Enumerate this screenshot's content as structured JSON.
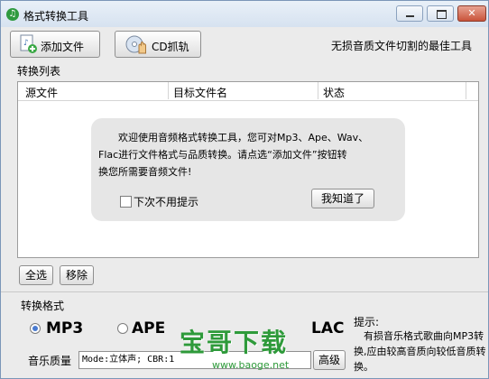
{
  "window": {
    "title": "格式转换工具"
  },
  "toolbar": {
    "add_label": "添加文件",
    "cd_label": "CD抓轨",
    "slogan": "无损音质文件切割的最佳工具"
  },
  "list": {
    "group_label": "转换列表",
    "columns": [
      "源文件",
      "目标文件名",
      "状态"
    ]
  },
  "tip": {
    "lines": [
      "欢迎使用音频格式转换工具，您可对Mp3、Ape、Wav、",
      "Flac进行文件格式与品质转换。请点选“添加文件”按钮转",
      "换您所需要音频文件!"
    ],
    "checkbox_label": "下次不用提示",
    "ok_label": "我知道了"
  },
  "actions": {
    "select_all": "全选",
    "remove": "移除"
  },
  "format": {
    "label": "转换格式",
    "options": [
      {
        "label": "MP3",
        "selected": true
      },
      {
        "label": "APE",
        "selected": false
      },
      {
        "label": "LAC",
        "selected": false
      }
    ],
    "quality_label": "音乐质量",
    "quality_value": "Mode:立体声; CBR:1",
    "advanced_label": "高级"
  },
  "hint": {
    "title": "提示:",
    "body": "有损音乐格式歌曲向MP3转换,应由较高音质向较低音质转换。"
  },
  "watermark": {
    "text": "宝哥下载",
    "url": "www.baoge.net"
  },
  "colors": {
    "watermark": "#2e9a3a",
    "radio_selected": "#4a7bd0",
    "close_button": "#c9533a"
  }
}
